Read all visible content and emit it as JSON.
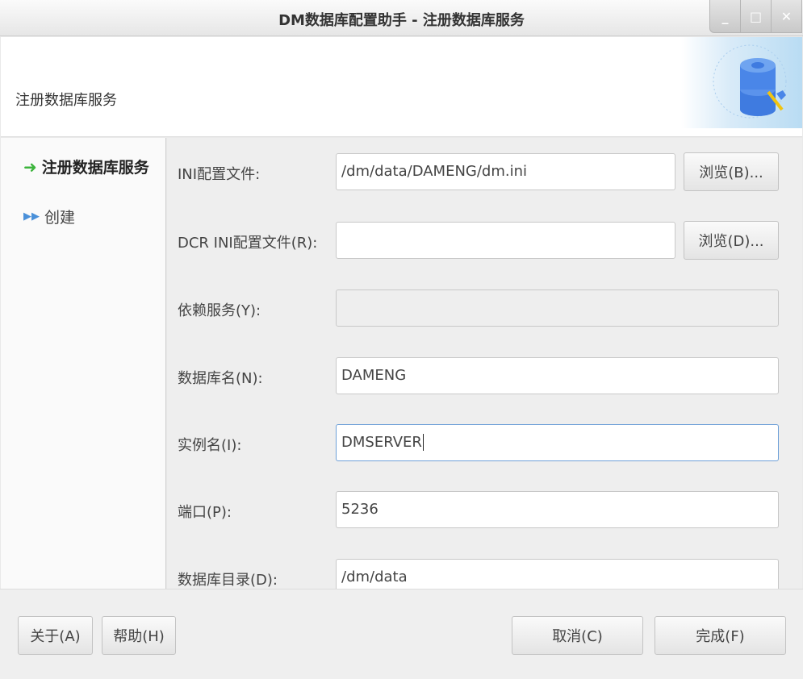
{
  "window": {
    "title": "DM数据库配置助手 - 注册数据库服务",
    "minimize": "_",
    "maximize": "□",
    "close": "✕"
  },
  "header": {
    "title": "注册数据库服务",
    "icon": "database-tools-icon"
  },
  "sidebar": {
    "items": [
      {
        "label": "注册数据库服务",
        "icon": "green-arrow-icon",
        "active": true
      },
      {
        "label": "创建",
        "icon": "double-arrow-icon",
        "active": false
      }
    ]
  },
  "form": {
    "ini": {
      "label": "INI配置文件:",
      "value": "/dm/data/DAMENG/dm.ini",
      "browse": "浏览(B)..."
    },
    "dcr": {
      "label": "DCR INI配置文件(R):",
      "value": "",
      "browse": "浏览(D)..."
    },
    "dep": {
      "label": "依赖服务(Y):",
      "value": ""
    },
    "dbname": {
      "label": "数据库名(N):",
      "value": "DAMENG"
    },
    "instance": {
      "label": "实例名(I):",
      "value": "DMSERVER"
    },
    "port": {
      "label": "端口(P):",
      "value": "5236"
    },
    "dir": {
      "label": "数据库目录(D):",
      "value": "/dm/data"
    }
  },
  "footer": {
    "about": "关于(A)",
    "help": "帮助(H)",
    "cancel": "取消(C)",
    "finish": "完成(F)"
  }
}
